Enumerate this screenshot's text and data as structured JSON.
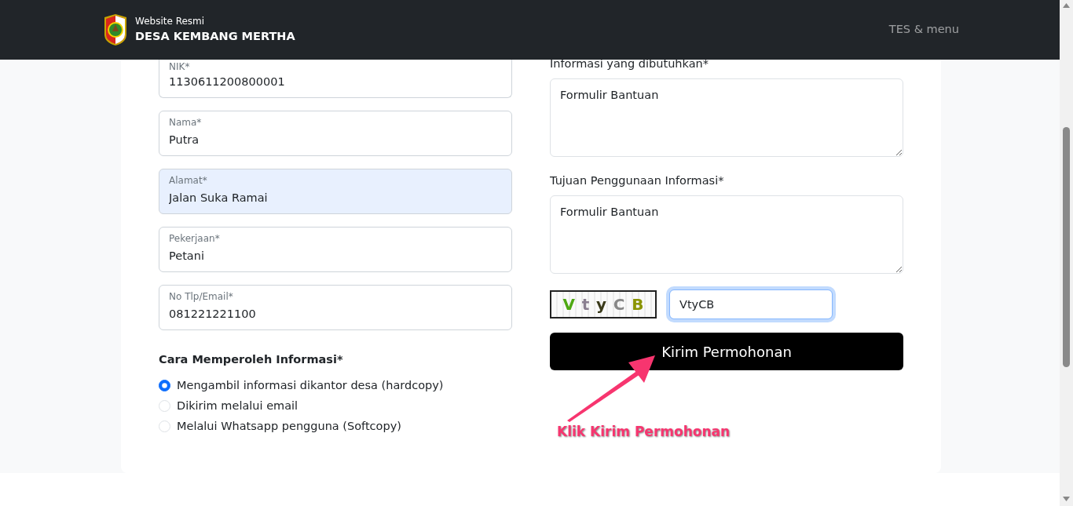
{
  "header": {
    "subtitle": "Website Resmi",
    "title": "DESA KEMBANG MERTHA",
    "menu": "TES & menu"
  },
  "fields": [
    {
      "label": "NIK*",
      "value": "1130611200800001",
      "autofilled": false
    },
    {
      "label": "Nama*",
      "value": "Putra",
      "autofilled": false
    },
    {
      "label": "Alamat*",
      "value": "Jalan Suka Ramai",
      "autofilled": true
    },
    {
      "label": "Pekerjaan*",
      "value": "Petani",
      "autofilled": false
    },
    {
      "label": "No Tlp/Email*",
      "value": "081221221100",
      "autofilled": false
    }
  ],
  "method": {
    "heading": "Cara Memperoleh Informasi*",
    "options": [
      {
        "label": "Mengambil informasi dikantor desa (hardcopy)",
        "selected": true
      },
      {
        "label": "Dikirim melalui email",
        "selected": false
      },
      {
        "label": "Melalui Whatsapp pengguna (Softcopy)",
        "selected": false
      }
    ]
  },
  "textareas": [
    {
      "label": "Informasi yang dibutuhkan*",
      "value": "Formulir Bantuan"
    },
    {
      "label": "Tujuan Penggunaan Informasi*",
      "value": "Formulir Bantuan"
    }
  ],
  "captcha": {
    "letters": [
      {
        "char": "V",
        "color": "#4ea812"
      },
      {
        "char": "t",
        "color": "#8a7f90"
      },
      {
        "char": "y",
        "color": "#3a3a1a"
      },
      {
        "char": "C",
        "color": "#888888"
      },
      {
        "char": "B",
        "color": "#8a9400"
      }
    ],
    "input": {
      "value": "VtyCB",
      "focused": true
    }
  },
  "submit": "Kirim Permohonan",
  "annotation": "Klik Kirim Permohonan"
}
